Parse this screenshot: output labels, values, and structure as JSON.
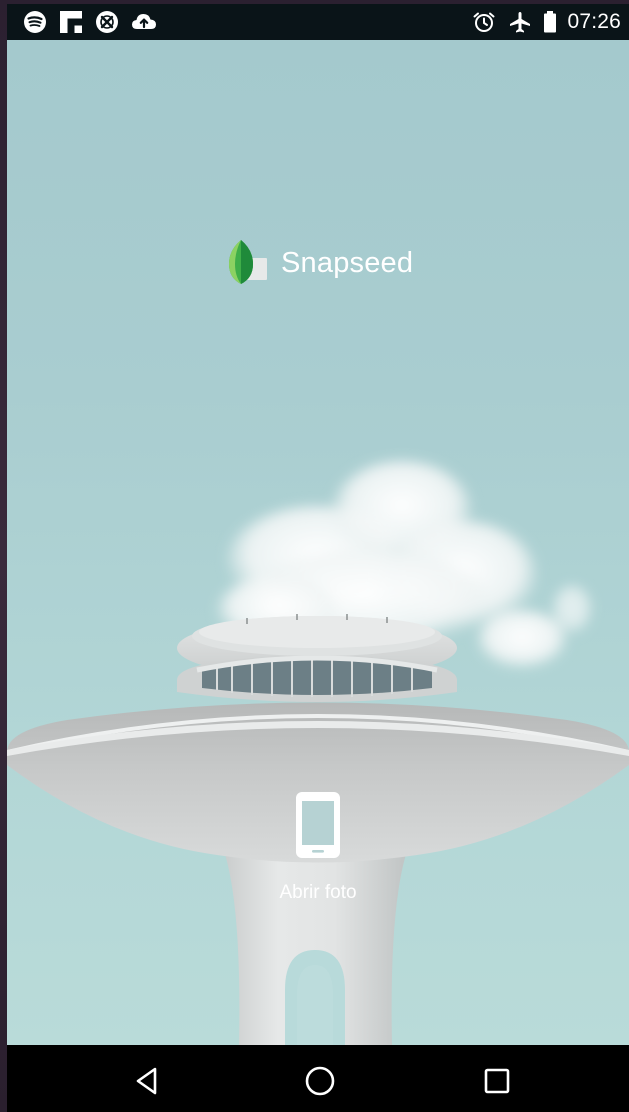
{
  "status_bar": {
    "left_icons": [
      "spotify-icon",
      "flipboard-icon",
      "sync-off-icon",
      "cloud-upload-icon"
    ],
    "right_icons": [
      "alarm-icon",
      "airplane-mode-icon",
      "battery-icon"
    ],
    "time": "07:26"
  },
  "app": {
    "name": "Snapseed",
    "logo_icon": "snapseed-leaf-logo"
  },
  "open_photo": {
    "icon": "phone-icon",
    "label": "Abrir foto"
  },
  "nav_bar": {
    "buttons": [
      "back-icon",
      "home-icon",
      "recents-icon"
    ]
  },
  "colors": {
    "sky": "#a9cdd0",
    "status_bar": "#0a1418",
    "nav_bar": "#000000",
    "leaf_green": "#3fae49",
    "text": "#ffffff"
  }
}
